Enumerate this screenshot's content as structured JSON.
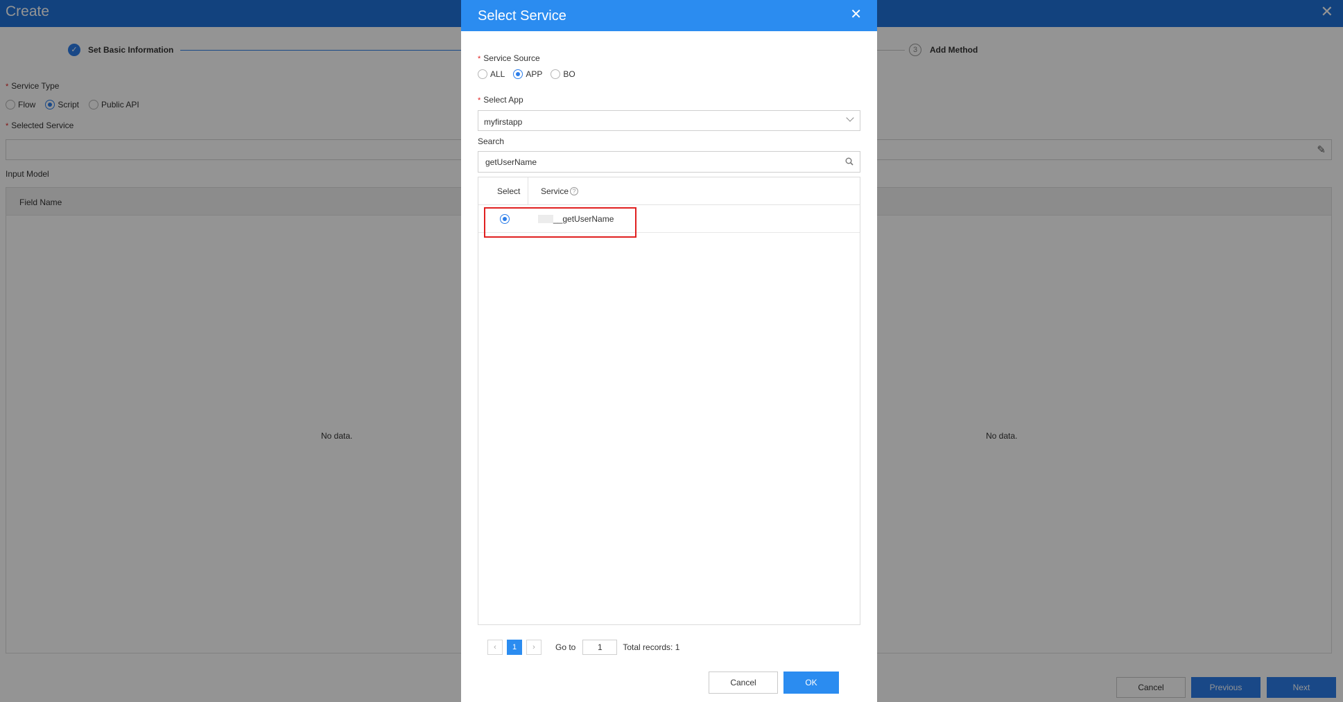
{
  "background": {
    "title": "Create",
    "steps": [
      {
        "label": "Set Basic Information",
        "state": "done"
      },
      {
        "label": "Add Method",
        "state": "todo",
        "number": "3"
      }
    ],
    "service_type_label": "Service Type",
    "service_type_options": [
      "Flow",
      "Script",
      "Public API"
    ],
    "service_type_selected": "Script",
    "selected_service_label": "Selected Service",
    "input_model_label": "Input Model",
    "field_name_header": "Field Name",
    "no_data": "No data.",
    "buttons": {
      "cancel": "Cancel",
      "previous": "Previous",
      "next": "Next"
    }
  },
  "modal": {
    "title": "Select Service",
    "service_source_label": "Service Source",
    "service_source_options": [
      "ALL",
      "APP",
      "BO"
    ],
    "service_source_selected": "APP",
    "select_app_label": "Select App",
    "select_app_value": "myfirstapp",
    "search_label": "Search",
    "search_value": "getUserName",
    "table": {
      "headers": {
        "select": "Select",
        "service": "Service"
      },
      "rows": [
        {
          "service": "__getUserName",
          "selected": true
        }
      ]
    },
    "pagination": {
      "current_page": "1",
      "goto_label": "Go to",
      "goto_value": "1",
      "total": "Total records: 1"
    },
    "buttons": {
      "cancel": "Cancel",
      "ok": "OK"
    }
  },
  "colors": {
    "header_blue": "#1f72d9",
    "modal_header": "#2b8cf0",
    "accent": "#2b7de9",
    "highlight": "#e02020"
  }
}
